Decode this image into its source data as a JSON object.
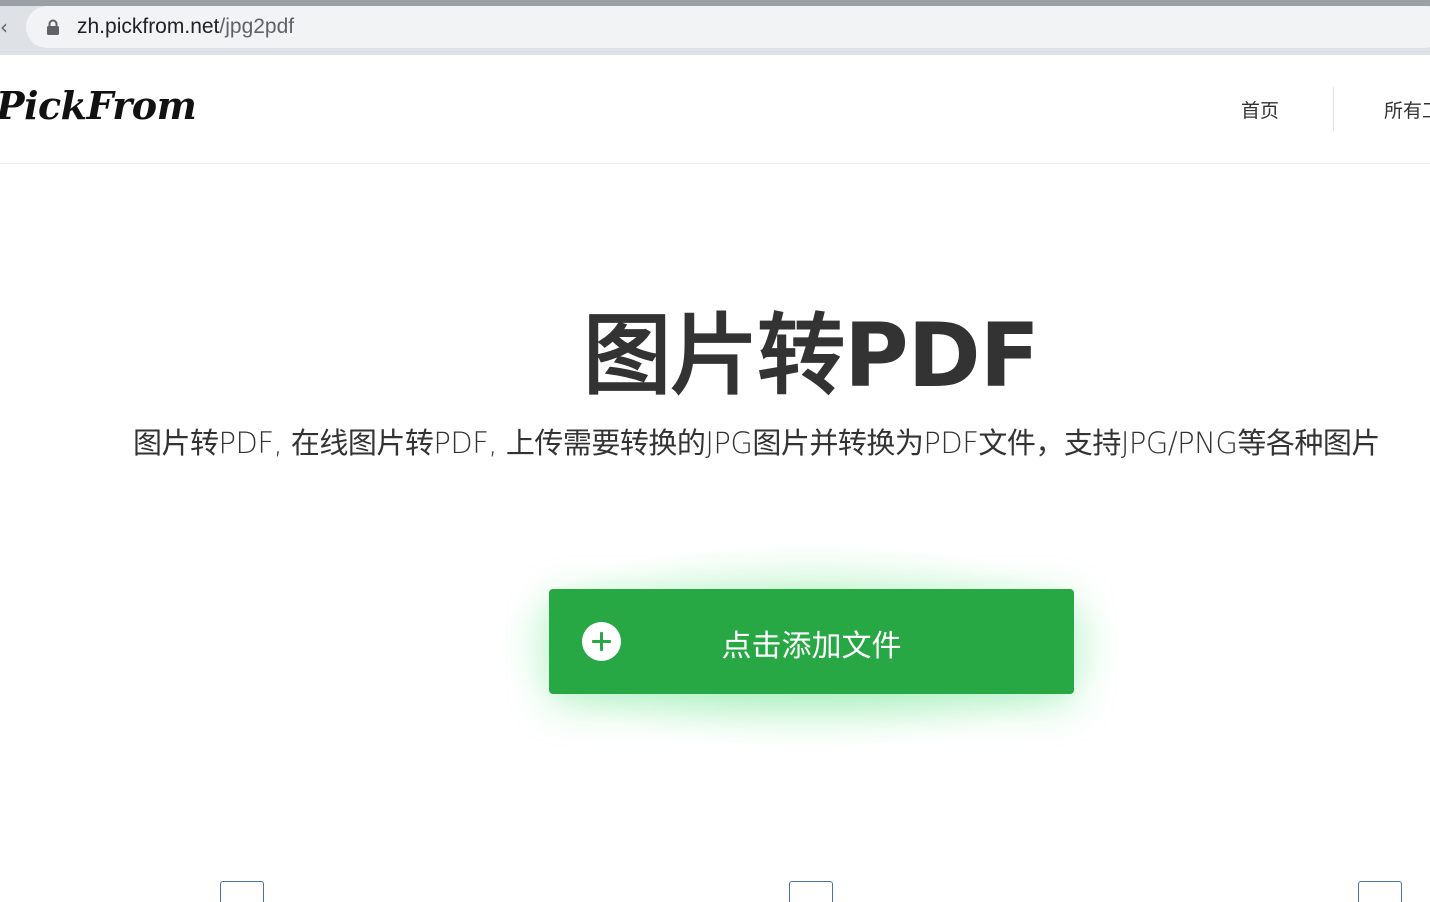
{
  "browser": {
    "url_host": "zh.pickfrom.net",
    "url_path": "/jpg2pdf"
  },
  "header": {
    "logo": "PickFrom",
    "nav": {
      "home": "首页",
      "all_tools": "所有工"
    }
  },
  "hero": {
    "title": "图片转PDF",
    "subtitle": "图片转PDF, 在线图片转PDF, 上传需要转换的JPG图片并转换为PDF文件，支持JPG/PNG等各种图片"
  },
  "upload": {
    "label": "点击添加文件",
    "icon": "plus-circle-icon",
    "color": "#28a745"
  },
  "icons": {
    "lock": "lock-icon",
    "back": "back-arrow-icon"
  }
}
